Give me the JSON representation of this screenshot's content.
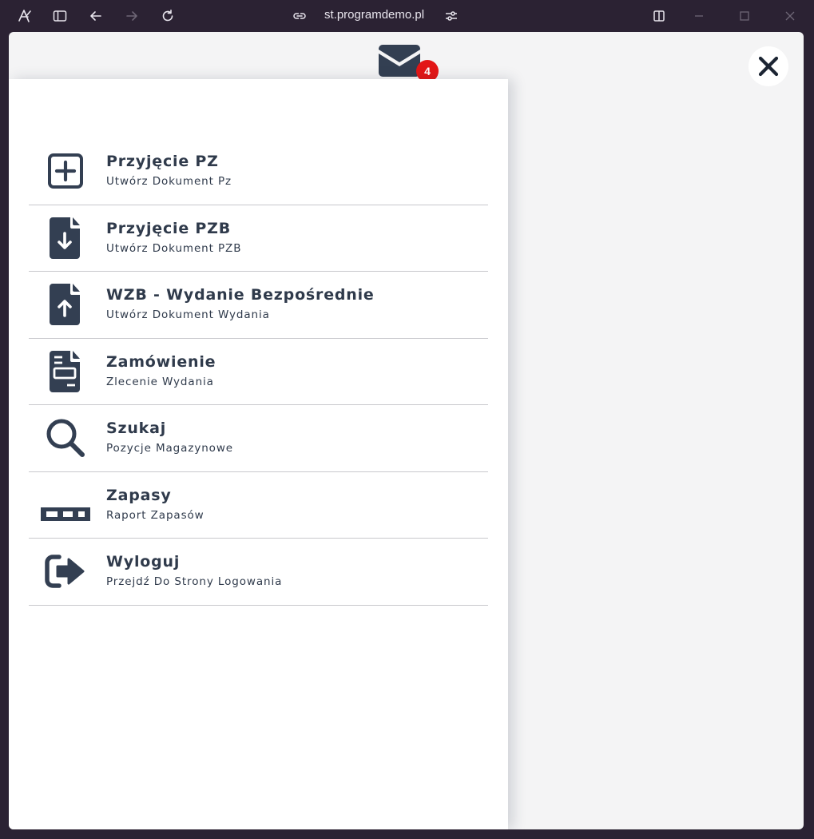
{
  "browser": {
    "url": "st.programdemo.pl"
  },
  "header": {
    "mail_count": "4"
  },
  "colors": {
    "icon": "#333f52",
    "badge": "#e31616"
  },
  "menu": {
    "items": [
      {
        "title": "Przyjęcie PZ",
        "subtitle": "Utwórz Dokument Pz",
        "icon": "plus-square-icon"
      },
      {
        "title": "Przyjęcie PZB",
        "subtitle": "Utwórz Dokument PZB",
        "icon": "file-download-icon"
      },
      {
        "title": "WZB - Wydanie Bezpośrednie",
        "subtitle": "Utwórz Dokument Wydania",
        "icon": "file-upload-icon"
      },
      {
        "title": "Zamówienie",
        "subtitle": "Zlecenie Wydania",
        "icon": "file-invoice-icon"
      },
      {
        "title": "Szukaj",
        "subtitle": "Pozycje Magazynowe",
        "icon": "search-icon"
      },
      {
        "title": "Zapasy",
        "subtitle": "Raport Zapasów",
        "icon": "pallet-icon"
      },
      {
        "title": "Wyloguj",
        "subtitle": "Przejdź Do Strony Logowania",
        "icon": "sign-out-icon"
      }
    ]
  }
}
